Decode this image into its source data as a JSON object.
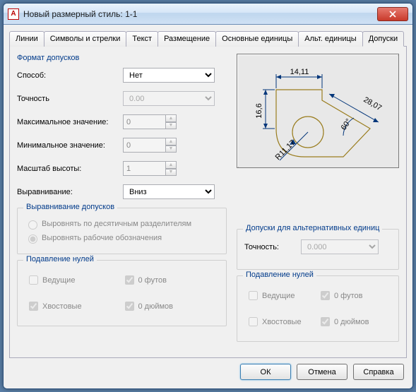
{
  "window": {
    "title": "Новый размерный стиль: 1-1"
  },
  "tabs": [
    "Линии",
    "Символы и стрелки",
    "Текст",
    "Размещение",
    "Основные единицы",
    "Альт. единицы",
    "Допуски"
  ],
  "active_tab_index": 6,
  "tolerance_format": {
    "group_title": "Формат допусков",
    "method_label": "Способ:",
    "method_value": "Нет",
    "precision_label": "Точность",
    "precision_value": "0.00",
    "max_label": "Максимальное значение:",
    "max_value": "0",
    "min_label": "Минимальное значение:",
    "min_value": "0",
    "scale_label": "Масштаб высоты:",
    "scale_value": "1",
    "align_label": "Выравнивание:",
    "align_value": "Вниз"
  },
  "tolerance_align": {
    "group_title": "Выравнивание допусков",
    "opt1": "Выровнять по десятичным разделителям",
    "opt2": "Выровнять рабочие обозначения"
  },
  "zero_suppress": {
    "group_title": "Подавление нулей",
    "leading": "Ведущие",
    "trailing": "Хвостовые",
    "feet": "0 футов",
    "inches": "0 дюймов"
  },
  "alt_tol": {
    "group_title": "Допуски для альтернативных единиц",
    "precision_label": "Точность:",
    "precision_value": "0.000"
  },
  "alt_zero_suppress": {
    "group_title": "Подавление нулей",
    "leading": "Ведущие",
    "trailing": "Хвостовые",
    "feet": "0 футов",
    "inches": "0 дюймов"
  },
  "preview": {
    "d_top": "14,11",
    "d_left": "16,6",
    "d_right": "28,07",
    "angle": "60°",
    "radius": "R11,17"
  },
  "buttons": {
    "ok": "ОК",
    "cancel": "Отмена",
    "help": "Справка"
  }
}
